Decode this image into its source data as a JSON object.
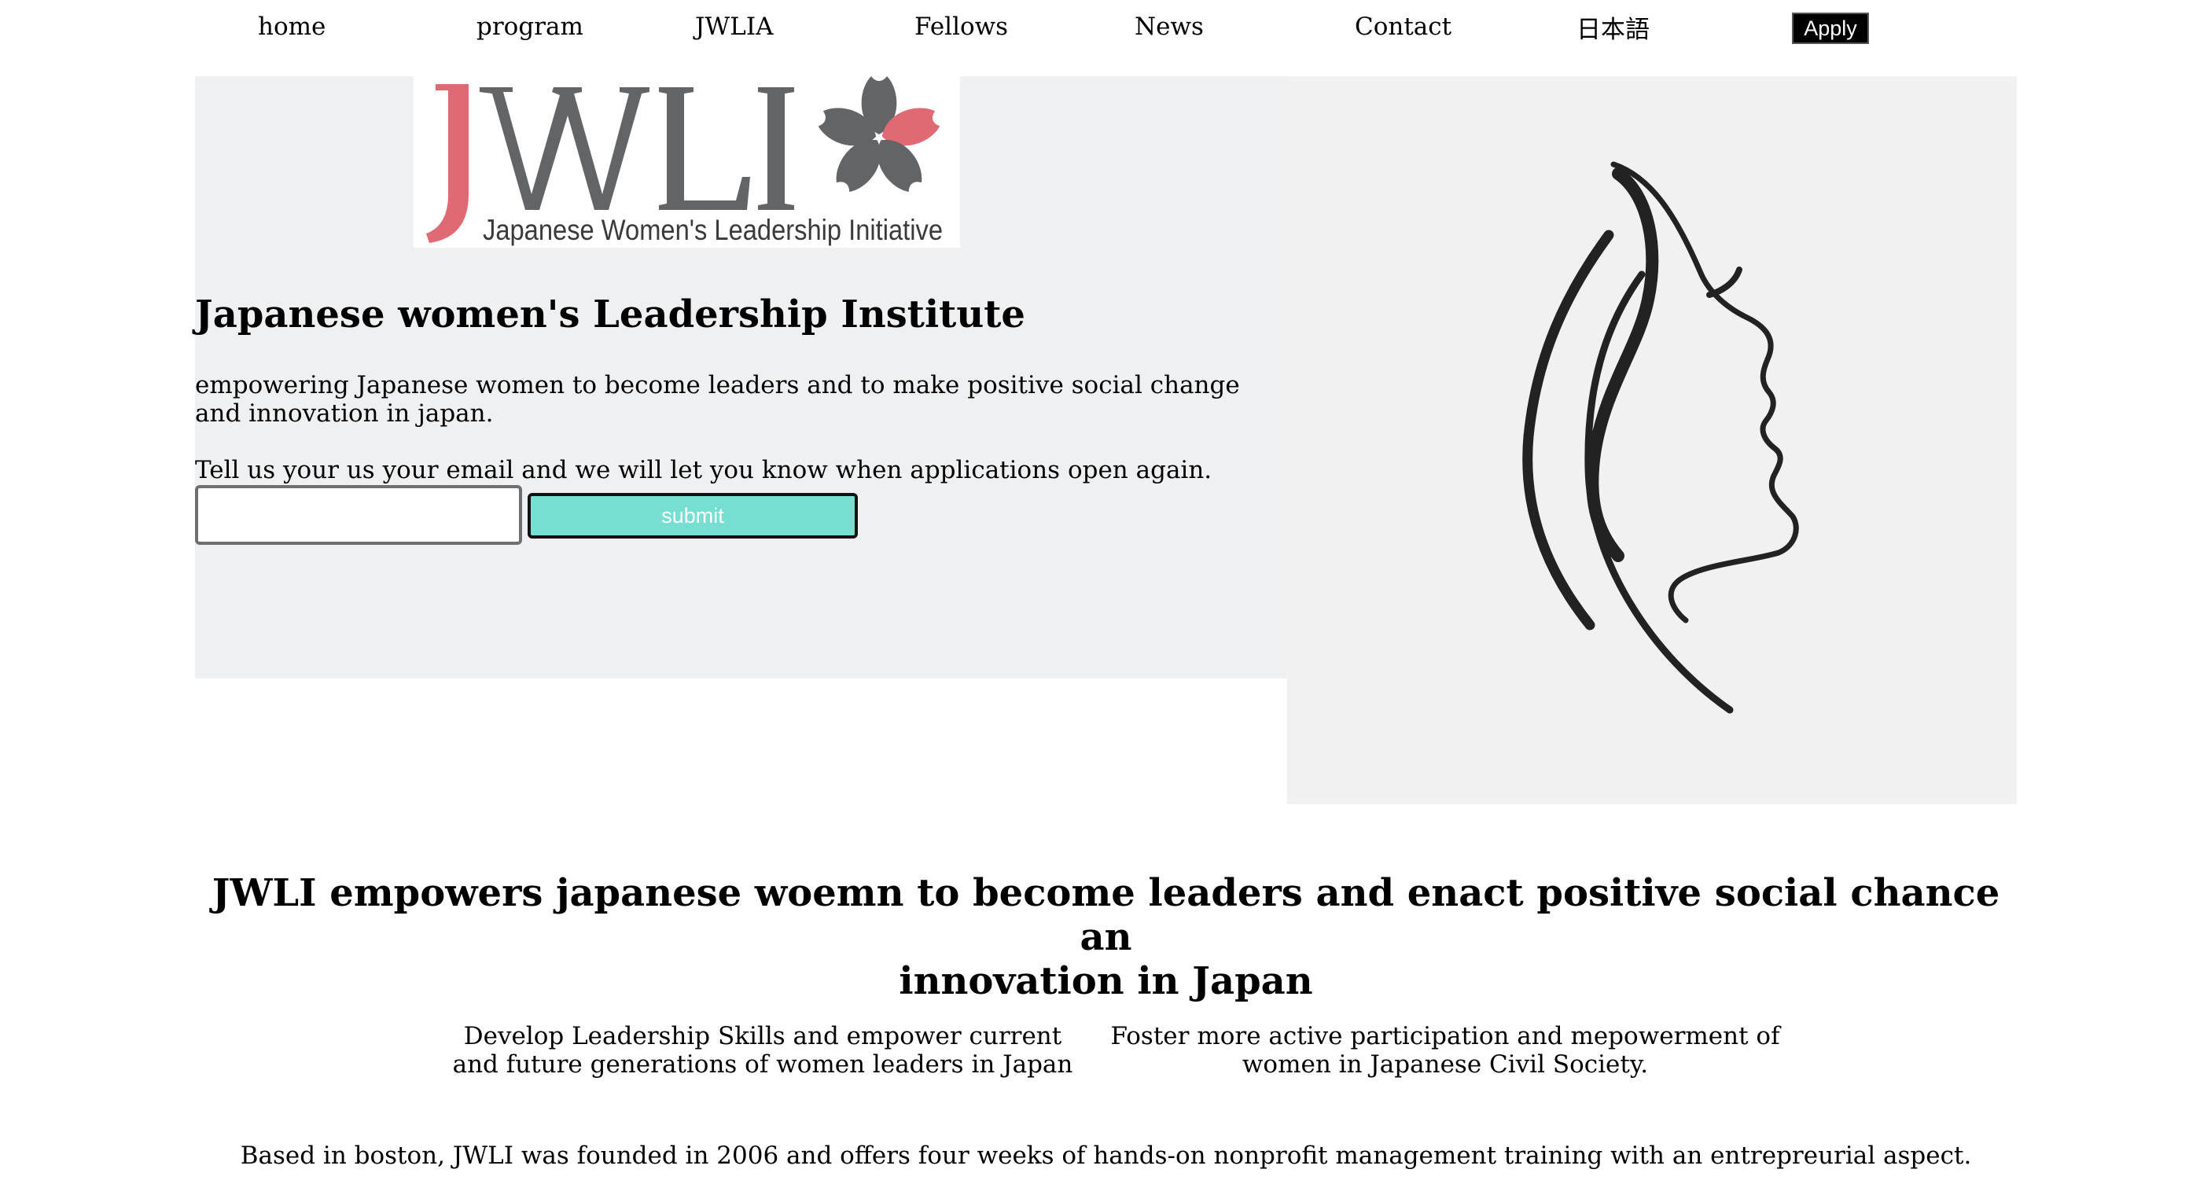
{
  "nav": {
    "items": [
      {
        "label": "home"
      },
      {
        "label": "program"
      },
      {
        "label": "JWLIA"
      },
      {
        "label": "Fellows"
      },
      {
        "label": "News"
      },
      {
        "label": "Contact"
      },
      {
        "label": "日本語"
      }
    ],
    "apply_label": "Apply"
  },
  "logo": {
    "letters": "JWLI",
    "tagline": "Japanese Women's Leadership Initiative",
    "colors": {
      "pink": "#e06a74",
      "gray": "#636466"
    }
  },
  "hero": {
    "title": "Japanese women's Leadership Institute",
    "subtitle": "empowering Japanese women to become leaders and to make positive social change and innovation in japan.",
    "cta_text": "Tell us your us your email and we will let you know when applications open again.",
    "email_value": "",
    "submit_label": "submit",
    "submit_color": "#76dfd1"
  },
  "mission": {
    "line1": "JWLI empowers japanese woemn to become leaders and enact positive social chance an",
    "line2": "innovation in Japan"
  },
  "pillars": [
    {
      "text": "Develop Leadership Skills and empower current and future generations of women leaders in Japan"
    },
    {
      "text": "Foster more active participation and mepowerment of women in Japanese Civil Society."
    }
  ],
  "about": {
    "text": "Based in boston, JWLI was founded in 2006 and offers four weeks of hands-on nonprofit management training with an entrepreurial aspect."
  }
}
